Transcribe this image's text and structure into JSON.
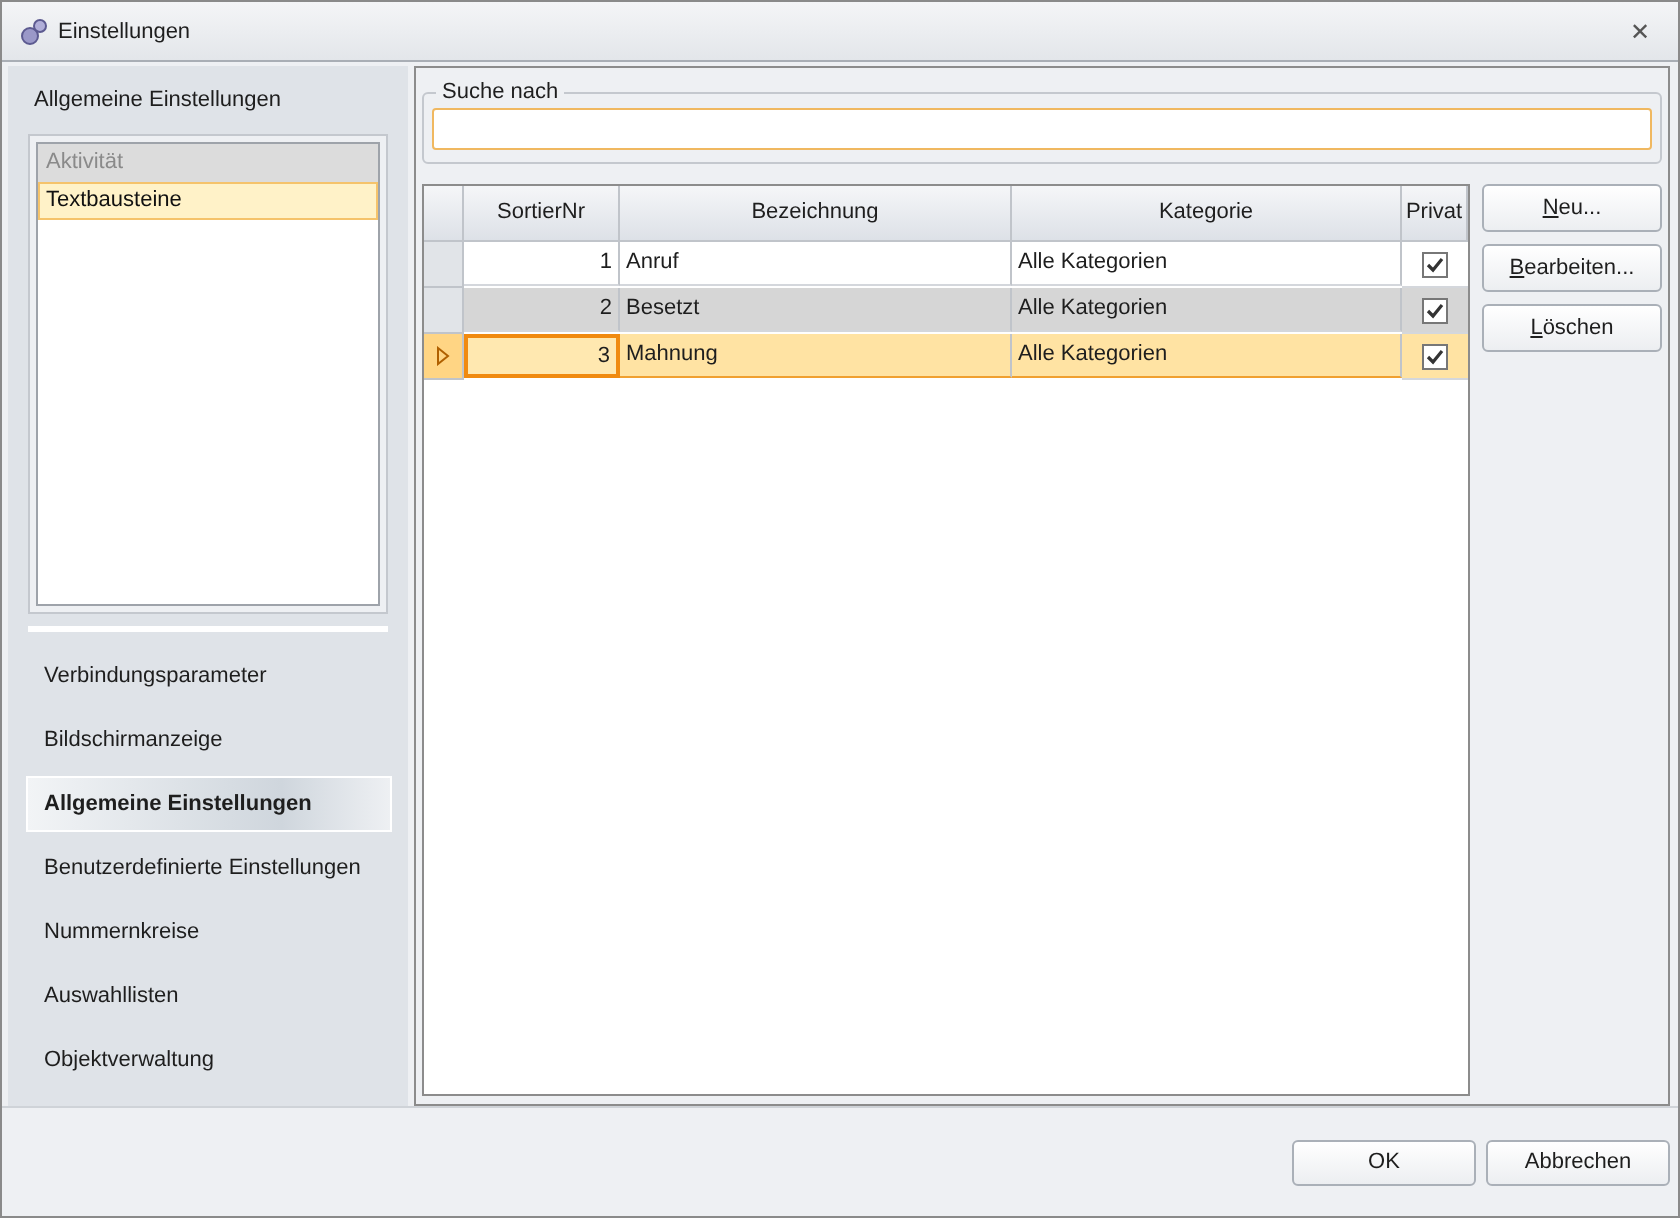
{
  "window": {
    "title": "Einstellungen",
    "close": "✕"
  },
  "sidebar": {
    "section_title": "Allgemeine Einstellungen",
    "list": [
      {
        "label": "Aktivität",
        "kind": "group",
        "selected": false
      },
      {
        "label": "Textbausteine",
        "kind": "item",
        "selected": true
      }
    ],
    "items": [
      {
        "label": "Verbindungsparameter",
        "selected": false
      },
      {
        "label": "Bildschirmanzeige",
        "selected": false
      },
      {
        "label": "Allgemeine Einstellungen",
        "selected": true
      },
      {
        "label": "Benutzerdefinierte Einstellungen",
        "selected": false
      },
      {
        "label": "Nummernkreise",
        "selected": false
      },
      {
        "label": "Auswahllisten",
        "selected": false
      },
      {
        "label": "Objektverwaltung",
        "selected": false
      }
    ]
  },
  "search": {
    "label": "Suche nach"
  },
  "table": {
    "columns": [
      "SortierNr",
      "Bezeichnung",
      "Kategorie",
      "Privat"
    ],
    "rows": [
      {
        "nr": "1",
        "name": "Anruf",
        "category": "Alle Kategorien",
        "private": true,
        "selected": false,
        "shaded": false
      },
      {
        "nr": "2",
        "name": "Besetzt",
        "category": "Alle Kategorien",
        "private": true,
        "selected": false,
        "shaded": true
      },
      {
        "nr": "3",
        "name": "Mahnung",
        "category": "Alle Kategorien",
        "private": true,
        "selected": true,
        "shaded": false
      }
    ]
  },
  "side_buttons": [
    {
      "label": "Neu...",
      "underline_first": true
    },
    {
      "label": "Bearbeiten...",
      "underline_first": true
    },
    {
      "label": "Löschen",
      "underline_first": true
    }
  ],
  "footer_buttons": [
    "OK",
    "Abbrechen"
  ]
}
